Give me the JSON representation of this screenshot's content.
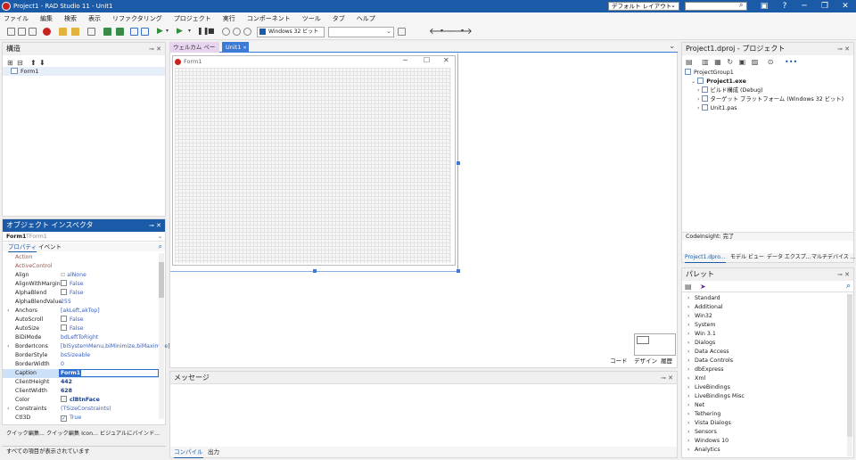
{
  "window": {
    "title": "Project1 - RAD Studio 11 - Unit1"
  },
  "menu": [
    "ファイル",
    "編集",
    "検索",
    "表示",
    "リファクタリング",
    "プロジェクト",
    "実行",
    "コンポーネント",
    "ツール",
    "タブ",
    "ヘルプ"
  ],
  "layout_selector": "デフォルト レイアウト",
  "platform_selector": "Windows 32 ビット",
  "structure": {
    "title": "構造",
    "root": "Form1"
  },
  "object_inspector": {
    "title": "オブジェクト インスペクタ",
    "selected": "Form1",
    "selected_type": "TForm1",
    "tabs": [
      "プロパティ",
      "イベント"
    ],
    "rows": [
      {
        "name": "Action",
        "value": "",
        "kind": "event"
      },
      {
        "name": "ActiveControl",
        "value": "",
        "kind": "event"
      },
      {
        "name": "Align",
        "value": "alNone",
        "kind": "enum"
      },
      {
        "name": "AlignWithMargins",
        "value": "False",
        "kind": "bool"
      },
      {
        "name": "AlphaBlend",
        "value": "False",
        "kind": "bool"
      },
      {
        "name": "AlphaBlendValue",
        "value": "255",
        "kind": "text"
      },
      {
        "name": "Anchors",
        "value": "[akLeft,akTop]",
        "kind": "text",
        "expand": true
      },
      {
        "name": "AutoScroll",
        "value": "False",
        "kind": "bool"
      },
      {
        "name": "AutoSize",
        "value": "False",
        "kind": "bool"
      },
      {
        "name": "BiDiMode",
        "value": "bdLeftToRight",
        "kind": "text"
      },
      {
        "name": "BorderIcons",
        "value": "[biSystemMenu,biMinimize,biMaximize]",
        "kind": "text",
        "expand": true
      },
      {
        "name": "BorderStyle",
        "value": "bsSizeable",
        "kind": "text"
      },
      {
        "name": "BorderWidth",
        "value": "0",
        "kind": "text"
      },
      {
        "name": "Caption",
        "value": "Form1",
        "kind": "edit"
      },
      {
        "name": "ClientHeight",
        "value": "442",
        "kind": "bold"
      },
      {
        "name": "ClientWidth",
        "value": "628",
        "kind": "bold"
      },
      {
        "name": "Color",
        "value": "clBtnFace",
        "kind": "bold"
      },
      {
        "name": "Constraints",
        "value": "(TSizeConstraints)",
        "kind": "text",
        "expand": true
      },
      {
        "name": "Ctl3D",
        "value": "True",
        "kind": "check"
      }
    ],
    "footer_links": "クイック編集... クイック編集 Icon... ビジュアルにバインド...",
    "status": "すべての項目が表示されています"
  },
  "editor": {
    "tabs": [
      "ウェルカム ページ",
      "Unit1"
    ],
    "form_caption": "Form1",
    "bottom_tabs": [
      "コード",
      "デザイン",
      "履歴"
    ]
  },
  "messages": {
    "title": "メッセージ",
    "tabs": [
      "コンパイル",
      "出力"
    ]
  },
  "project": {
    "title": "Project1.dproj - プロジェクト",
    "tree": [
      {
        "label": "ProjectGroup1",
        "level": 0,
        "bold": false
      },
      {
        "label": "Project1.exe",
        "level": 1,
        "bold": true
      },
      {
        "label": "ビルド構成 (Debug)",
        "level": 2,
        "bold": false
      },
      {
        "label": "ターゲット プラットフォーム (Windows 32 ビット)",
        "level": 2,
        "bold": false
      },
      {
        "label": "Unit1.pas",
        "level": 2,
        "bold": false
      }
    ],
    "codeinsight": "CodeInsight: 完了",
    "tabs": [
      "Project1.dpro...",
      "モデル ビュー",
      "データ エクスプ...",
      "マルチデバイス ..."
    ]
  },
  "palette": {
    "title": "パレット",
    "items": [
      "Standard",
      "Additional",
      "Win32",
      "System",
      "Win 3.1",
      "Dialogs",
      "Data Access",
      "Data Controls",
      "dbExpress",
      "Xml",
      "LiveBindings",
      "LiveBindings Misc",
      "Net",
      "Tethering",
      "Vista Dialogs",
      "Sensors",
      "Windows 10",
      "Analytics"
    ]
  }
}
